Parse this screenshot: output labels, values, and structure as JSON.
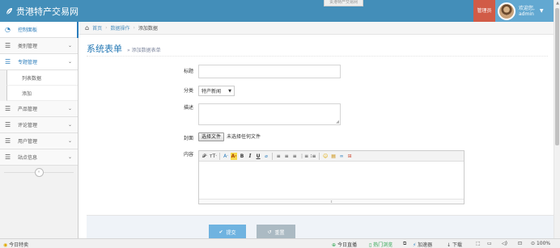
{
  "navbar": {
    "brand": "贵港特产交易网",
    "tooltip": "贵港特产交易网",
    "admin_badge": "管理员",
    "welcome": "欢迎您,",
    "username": "admin"
  },
  "sidebar": {
    "items": [
      {
        "label": "控制面板",
        "icon": "dashboard-icon"
      },
      {
        "label": "类别管理",
        "icon": "list-icon"
      },
      {
        "label": "专题管理",
        "icon": "list-icon"
      },
      {
        "label": "产品管理",
        "icon": "list-icon"
      },
      {
        "label": "评论管理",
        "icon": "list-icon"
      },
      {
        "label": "用户管理",
        "icon": "list-icon"
      },
      {
        "label": "站点信息",
        "icon": "list-icon"
      }
    ],
    "sub_items": [
      "列表数据",
      "添加"
    ]
  },
  "breadcrumb": {
    "home": "首页",
    "level2": "数据操作",
    "current": "添加数据"
  },
  "page": {
    "title": "系统表单",
    "subtitle": "» 添加数据表单"
  },
  "form": {
    "title_label": "标题",
    "category_label": "分类",
    "category_value": "特产新闻",
    "description_label": "描述",
    "cover_label": "封面",
    "file_button": "选择文件",
    "file_status": "未选择任何文件",
    "content_label": "内容"
  },
  "editor": {
    "tools": [
      "𝓕·",
      "ᴛT·",
      "A·",
      "A·",
      "B",
      "I",
      "U",
      "⌀",
      "≡",
      "≡",
      "≡",
      "⋮≡",
      "⁝≡",
      "☺",
      "▤",
      "∞",
      "⊞"
    ]
  },
  "actions": {
    "submit": "提交",
    "reset": "重置"
  },
  "statusbar": {
    "left": "今日特卖",
    "live": "今日直播",
    "phone": "热门浏览",
    "accel": "加速器",
    "download": "下载",
    "zoom": "100%"
  },
  "colors": {
    "navbar": "#438eb9",
    "admin_badge": "#d15b47",
    "accent": "#2679b5",
    "submit": "#6fb3e0",
    "reset": "#abbac3"
  }
}
